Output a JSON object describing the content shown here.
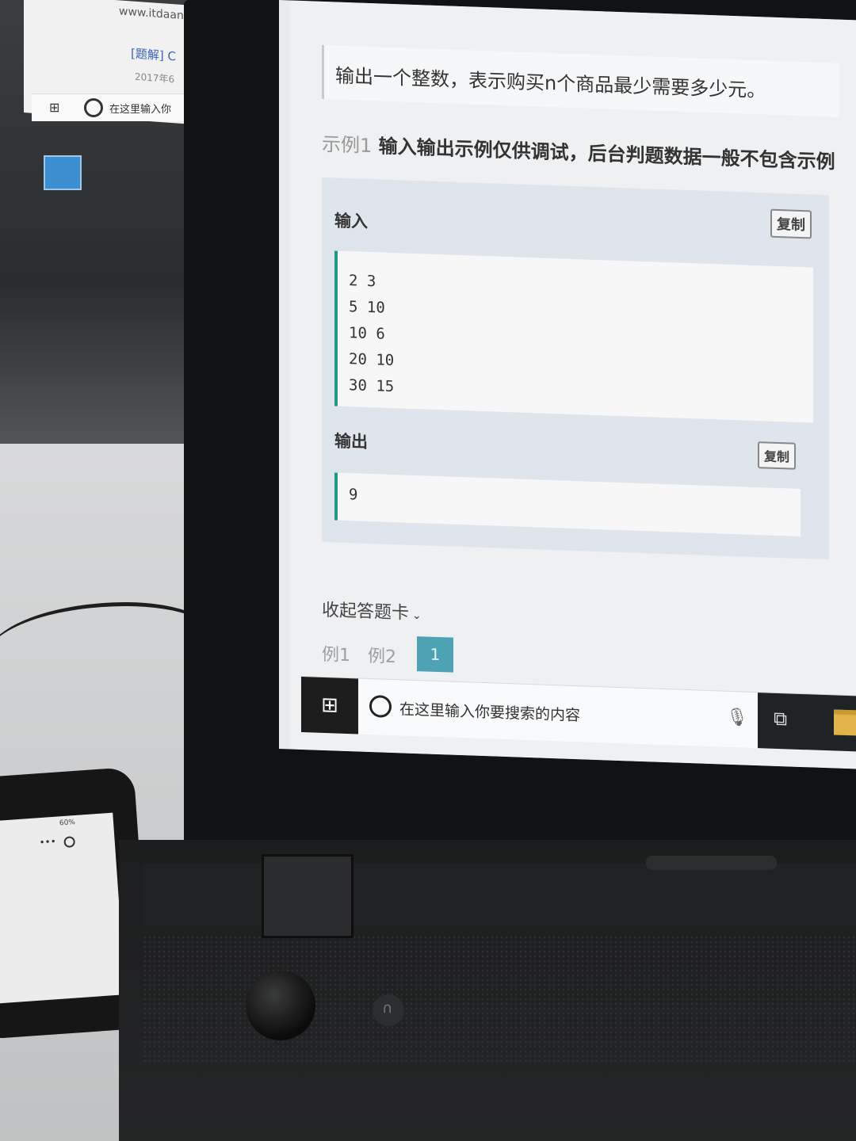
{
  "background_monitor": {
    "url_text": "www.itdaan",
    "label_text": "[题解] C",
    "date_text": "2017年6",
    "taskbar_search_text": "在这里输入你"
  },
  "phone": {
    "status_text": "60%"
  },
  "laptop_screen": {
    "description": "输出一个整数，表示购买n个商品最少需要多少元。",
    "example_heading_prefix": "示例1",
    "example_heading_text": "输入输出示例仅供调试，后台判题数据一般不包含示例",
    "input_panel": {
      "label": "输入",
      "copy_label": "复制",
      "lines": [
        "2 3",
        "5 10",
        "10 6",
        "20 10",
        "30 15"
      ]
    },
    "output_panel": {
      "label": "输出",
      "copy_label": "复制",
      "lines": [
        "9"
      ]
    },
    "answer_card": {
      "collapse_label": "收起答题卡",
      "items": [
        "例1",
        "例2",
        "1"
      ],
      "active_index": 2
    },
    "taskbar": {
      "search_placeholder": "在这里输入你要搜索的内容"
    }
  }
}
